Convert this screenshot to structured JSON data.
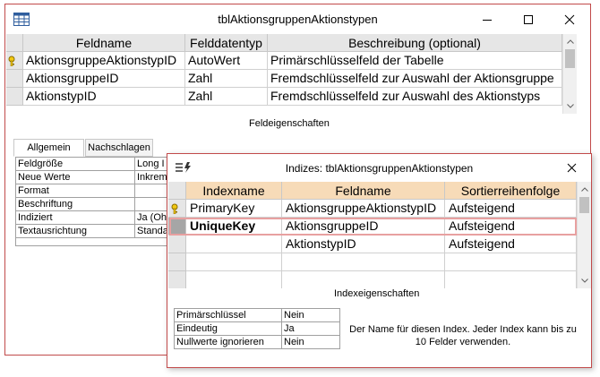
{
  "main_window": {
    "title": "tblAktionsgruppenAktionstypen",
    "columns": [
      "Feldname",
      "Felddatentyp",
      "Beschreibung (optional)"
    ],
    "rows": [
      {
        "feldname": "AktionsgruppeAktionstypID",
        "datentyp": "AutoWert",
        "beschreibung": "Primärschlüsselfeld der Tabelle",
        "primary_key": true
      },
      {
        "feldname": "AktionsgruppeID",
        "datentyp": "Zahl",
        "beschreibung": "Fremdschlüsselfeld zur Auswahl der Aktionsgruppe",
        "primary_key": false
      },
      {
        "feldname": "AktionstypID",
        "datentyp": "Zahl",
        "beschreibung": "Fremdschlüsselfeld zur Auswahl des Aktionstyps",
        "primary_key": false
      }
    ],
    "section_label": "Feldeigenschaften",
    "tabs": [
      "Allgemein",
      "Nachschlagen"
    ],
    "properties": [
      {
        "label": "Feldgröße",
        "value": "Long I"
      },
      {
        "label": "Neue Werte",
        "value": "Inkrem"
      },
      {
        "label": "Format",
        "value": ""
      },
      {
        "label": "Beschriftung",
        "value": ""
      },
      {
        "label": "Indiziert",
        "value": "Ja (Oh"
      },
      {
        "label": "Textausrichtung",
        "value": "Standa"
      }
    ]
  },
  "index_dialog": {
    "title": "Indizes: tblAktionsgruppenAktionstypen",
    "columns": [
      "Indexname",
      "Feldname",
      "Sortierreihenfolge"
    ],
    "rows": [
      {
        "indexname": "PrimaryKey",
        "feldname": "AktionsgruppeAktionstypID",
        "sort": "Aufsteigend",
        "primary_key": true,
        "selected": false
      },
      {
        "indexname": "UniqueKey",
        "feldname": "AktionsgruppeID",
        "sort": "Aufsteigend",
        "primary_key": false,
        "selected": true
      },
      {
        "indexname": "",
        "feldname": "AktionstypID",
        "sort": "Aufsteigend",
        "primary_key": false,
        "selected": false
      }
    ],
    "section_label": "Indexeigenschaften",
    "properties": [
      {
        "label": "Primärschlüssel",
        "value": "Nein"
      },
      {
        "label": "Eindeutig",
        "value": "Ja"
      },
      {
        "label": "Nullwerte ignorieren",
        "value": "Nein"
      }
    ],
    "help_text": "Der Name für diesen Index. Jeder Index kann bis zu 10 Felder verwenden."
  },
  "colors": {
    "window_border": "#c14a4a",
    "index_header": "#f7dbb8",
    "selection_outline": "#e8a0a0"
  }
}
